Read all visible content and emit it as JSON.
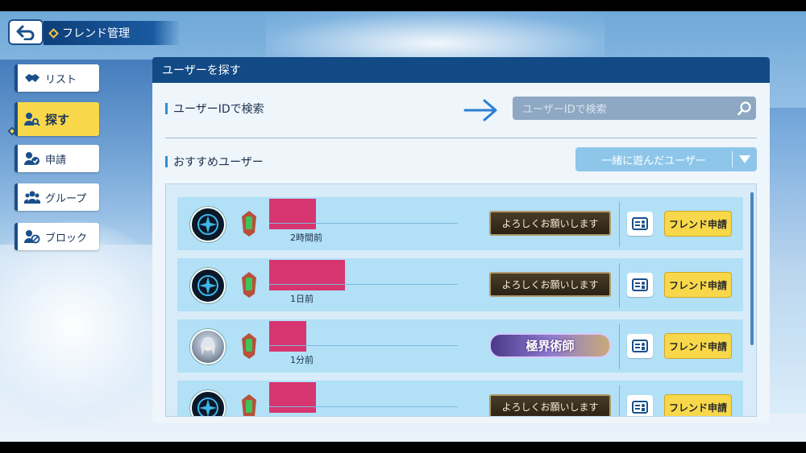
{
  "header": {
    "title": "フレンド管理"
  },
  "sidebar": {
    "items": [
      {
        "label": "リスト",
        "icon": "handshake-icon"
      },
      {
        "label": "探す",
        "icon": "user-search-icon",
        "active": true
      },
      {
        "label": "申請",
        "icon": "user-check-icon"
      },
      {
        "label": "グループ",
        "icon": "group-icon"
      },
      {
        "label": "ブロック",
        "icon": "user-block-icon"
      }
    ]
  },
  "panel": {
    "title": "ユーザーを探す",
    "search_label": "ユーザーIDで検索",
    "search_placeholder": "ユーザーIDで検索",
    "recommend_label": "おすすめユーザー",
    "filter_value": "一緒に遊んだユーザー"
  },
  "users": [
    {
      "last_login": "2時間前",
      "title": "よろしくお願いします",
      "button": "フレンド申請"
    },
    {
      "last_login": "1日前",
      "title": "よろしくお願いします",
      "button": "フレンド申請"
    },
    {
      "last_login": "1分前",
      "title": "極界術師",
      "button": "フレンド申請"
    },
    {
      "last_login": "",
      "title": "よろしくお願いします",
      "button": "フレンド申請"
    }
  ],
  "colors": {
    "accent": "#124a86",
    "button_yellow": "#f8d84a",
    "redaction": "#d7356f"
  }
}
